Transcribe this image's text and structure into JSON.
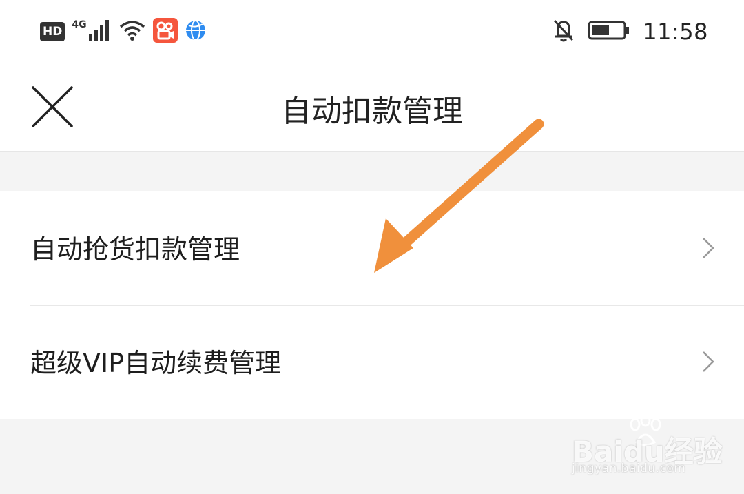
{
  "status_bar": {
    "hd_label": "HD",
    "network_label": "4G",
    "time": "11:58",
    "icons": [
      "signal-bars-icon",
      "wifi-icon",
      "kuaishou-app-icon",
      "browser-globe-icon",
      "bell-muted-icon",
      "battery-icon"
    ]
  },
  "header": {
    "title": "自动扣款管理",
    "close_icon": "close-icon"
  },
  "list": {
    "items": [
      {
        "label": "自动抢货扣款管理",
        "icon": "chevron-right-icon"
      },
      {
        "label": "超级VIP自动续费管理",
        "icon": "chevron-right-icon"
      }
    ]
  },
  "annotation": {
    "arrow_color": "#f0903c"
  },
  "watermark": {
    "brand": "Baidu经验",
    "url": "jingyan.baidu.com"
  }
}
